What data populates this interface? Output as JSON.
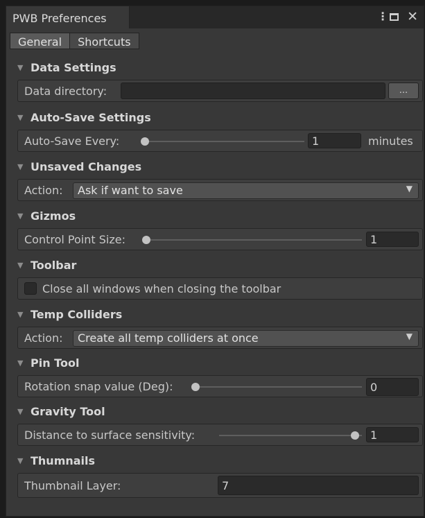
{
  "window": {
    "title": "PWB Preferences"
  },
  "tabs": [
    {
      "label": "General",
      "active": true
    },
    {
      "label": "Shortcuts",
      "active": false
    }
  ],
  "sections": {
    "data_settings": {
      "header": "Data Settings",
      "label": "Data directory:",
      "value": "",
      "browse_label": "..."
    },
    "auto_save": {
      "header": "Auto-Save Settings",
      "label": "Auto-Save Every:",
      "value": "1",
      "unit": "minutes"
    },
    "unsaved_changes": {
      "header": "Unsaved Changes",
      "label": "Action:",
      "selected": "Ask if want to save"
    },
    "gizmos": {
      "header": "Gizmos",
      "label": "Control Point Size:",
      "value": "1"
    },
    "toolbar": {
      "header": "Toolbar",
      "checkbox_label": "Close all windows when closing the toolbar",
      "checked": false
    },
    "temp_colliders": {
      "header": "Temp Colliders",
      "label": "Action:",
      "selected": "Create all temp colliders at once"
    },
    "pin_tool": {
      "header": "Pin Tool",
      "label": "Rotation snap value (Deg):",
      "value": "0"
    },
    "gravity_tool": {
      "header": "Gravity Tool",
      "label": "Distance to surface sensitivity:",
      "value": "1"
    },
    "thumbnails": {
      "header": "Thumnails",
      "label": "Thumbnail Layer:",
      "value": "7"
    }
  },
  "slider_levels": {
    "auto_save": 0.0,
    "gizmos": 0.0,
    "pin_tool": 0.0,
    "gravity_tool": 1.0
  },
  "colors": {
    "window_bg": "#383838",
    "panel_bg": "#3e3e3e",
    "field_bg": "#2a2a2a",
    "active_tab": "#5a5a5a"
  },
  "icons": [
    "more-options-icon",
    "maximize-icon",
    "close-icon",
    "foldout-arrow-icon",
    "dropdown-arrow-icon"
  ]
}
